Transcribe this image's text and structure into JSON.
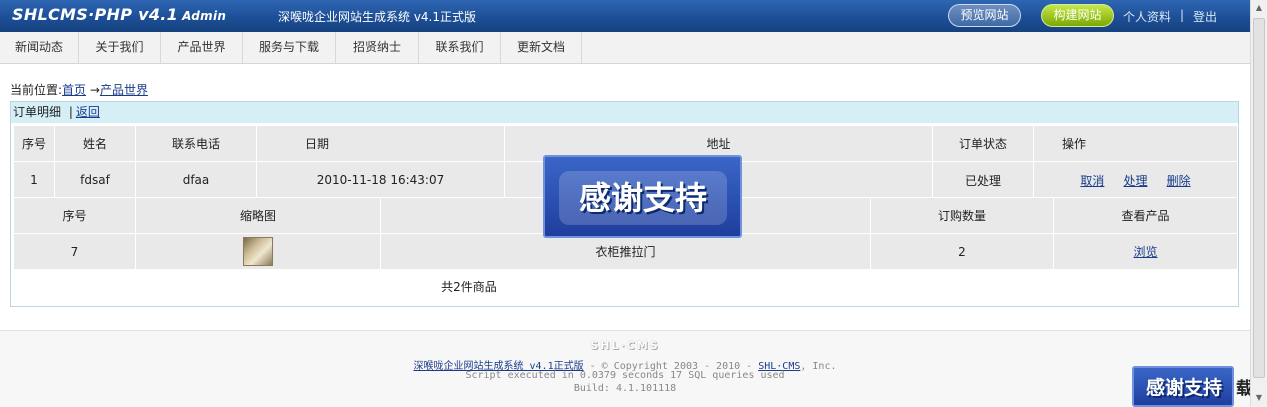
{
  "header": {
    "logo": "SHLCMS·PHP v4.1",
    "logo_suffix": "Admin",
    "subtitle": "深喉咙企业网站生成系统 v4.1正式版",
    "preview_label": "预览网站",
    "build_label": "构建网站",
    "profile_label": "个人资料",
    "separator": "|",
    "logout_label": "登出"
  },
  "nav": {
    "items": [
      {
        "label": "新闻动态"
      },
      {
        "label": "关于我们"
      },
      {
        "label": "产品世界"
      },
      {
        "label": "服务与下载"
      },
      {
        "label": "招贤纳士"
      },
      {
        "label": "联系我们"
      },
      {
        "label": "更新文档"
      }
    ]
  },
  "breadcrumb": {
    "prefix": "当前位置:",
    "home": "首页",
    "arrow": "→",
    "current": "产品世界"
  },
  "panel": {
    "title": "订单明细",
    "separator": "|",
    "back_label": "返回"
  },
  "order_table": {
    "headers": [
      "序号",
      "姓名",
      "联系电话",
      "日期",
      "地址",
      "订单状态",
      "操作"
    ],
    "row": {
      "no": "1",
      "name": "fdsaf",
      "phone": "dfaa",
      "date": "2010-11-18 16:43:07",
      "address": "",
      "status": "已处理",
      "action_cancel": "取消",
      "action_process": "处理",
      "action_delete": "删除"
    }
  },
  "items_table": {
    "headers": [
      "序号",
      "缩略图",
      "",
      "订购数量",
      "查看产品"
    ],
    "row": {
      "no": "7",
      "name": "衣柜推拉门",
      "quantity": "2",
      "view_label": "浏览"
    }
  },
  "total_text": "共2件商品",
  "watermark": {
    "text": "感谢支持",
    "side_text": "载"
  },
  "footer": {
    "logo": "SHL·CMS",
    "line1_link": "深喉咙企业网站生成系统 v4.1正式版",
    "line1_mid": " - © Copyright 2003 - 2010 - ",
    "line1_brand": "SHL·CMS",
    "line1_end": ", Inc.",
    "line2": "Script executed in 0.0379 seconds 17 SQL queries used",
    "line3": "Build: 4.1.101118"
  }
}
